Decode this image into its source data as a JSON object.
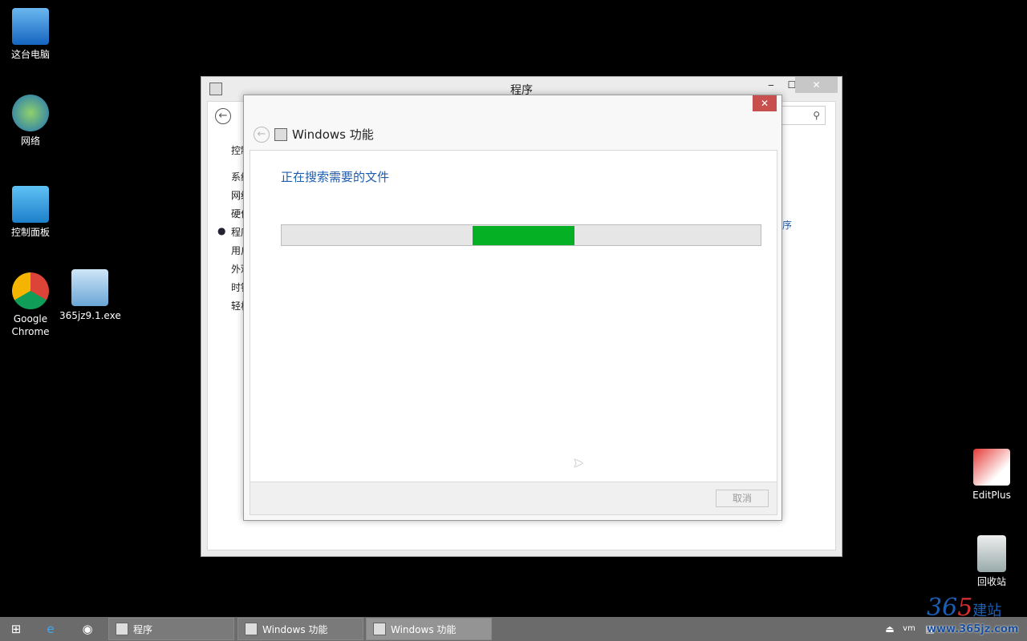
{
  "desktop": {
    "icons": [
      {
        "label": "这台电脑",
        "icon": "computer-icon"
      },
      {
        "label": "网络",
        "icon": "network-icon"
      },
      {
        "label": "控制面板",
        "icon": "control-panel-icon"
      },
      {
        "label": "Google Chrome",
        "icon": "chrome-icon"
      },
      {
        "label": "365jz9.1.exe",
        "icon": "installer-icon"
      },
      {
        "label": "EditPlus",
        "icon": "editplus-icon"
      },
      {
        "label": "回收站",
        "icon": "recycle-bin-icon"
      }
    ]
  },
  "bg_window": {
    "title": "程序",
    "nav": [
      "控制",
      "系统",
      "网络",
      "硬件",
      "程序",
      "用户",
      "外观",
      "时钟",
      "轻松"
    ],
    "right_link": "序",
    "search_icon": "search-icon"
  },
  "dialog": {
    "title": "Windows 功能",
    "message": "正在搜索需要的文件",
    "cancel_label": "取消",
    "progress_color": "#06b025",
    "progress_mode": "marquee"
  },
  "taskbar": {
    "items": [
      "程序",
      "Windows 功能",
      "Windows 功能"
    ]
  },
  "watermark": {
    "text": "365建站 www.365jz.com"
  }
}
